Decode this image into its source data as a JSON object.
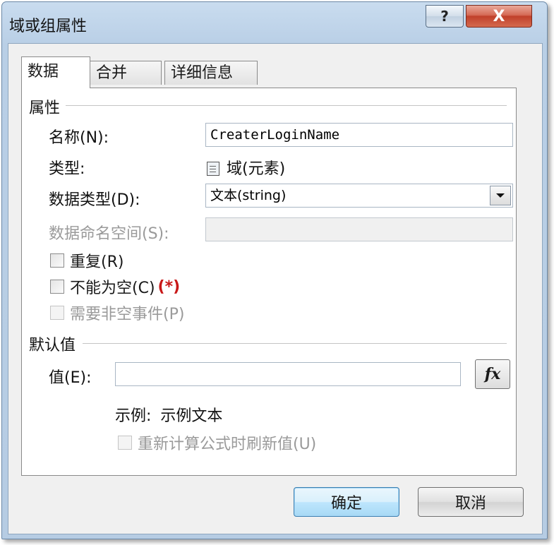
{
  "window": {
    "title": "域或组属性",
    "help_label": "?",
    "close_label": "X"
  },
  "tabs": [
    {
      "label": "数据",
      "active": true
    },
    {
      "label": "合并",
      "active": false
    },
    {
      "label": "详细信息",
      "active": false
    }
  ],
  "properties": {
    "section_label": "属性",
    "name_label": "名称(N):",
    "name_value": "CreaterLoginName",
    "type_label": "类型:",
    "type_value": "域(元素)",
    "type_icon": "document-icon",
    "datatype_label": "数据类型(D):",
    "datatype_value": "文本(string)",
    "namespace_label": "数据命名空间(S):",
    "namespace_value": "",
    "repeat_label": "重复(R)",
    "notnull_label": "不能为空(C)",
    "notnull_required": "(*)",
    "nonempty_event_label": "需要非空事件(P)"
  },
  "default_value": {
    "section_label": "默认值",
    "value_label": "值(E):",
    "value": "",
    "fx_label": "fx",
    "example_label": "示例:",
    "example_value": "示例文本",
    "recalc_label": "重新计算公式时刷新值(U)"
  },
  "buttons": {
    "ok_label": "确定",
    "cancel_label": "取消"
  },
  "colors": {
    "required": "#c81818",
    "default_button_border": "#3c7fb1"
  }
}
